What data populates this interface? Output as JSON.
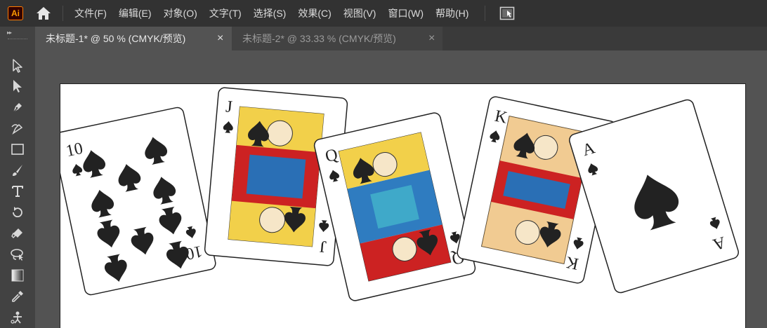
{
  "app": {
    "logo_text": "Ai"
  },
  "menu": {
    "items": [
      "文件(F)",
      "编辑(E)",
      "对象(O)",
      "文字(T)",
      "选择(S)",
      "效果(C)",
      "视图(V)",
      "窗口(W)",
      "帮助(H)"
    ]
  },
  "tabs": [
    {
      "label": "未标题-1* @ 50 % (CMYK/预览)",
      "active": true
    },
    {
      "label": "未标题-2* @ 33.33 % (CMYK/预览)",
      "active": false
    }
  ],
  "tab_close_glyph": "×",
  "tools": [
    "selection-tool-icon",
    "direct-selection-tool-icon",
    "pen-tool-icon",
    "curvature-tool-icon",
    "rectangle-tool-icon",
    "paintbrush-tool-icon",
    "type-tool-icon",
    "rotate-tool-icon",
    "eraser-tool-icon",
    "lasso-tool-icon",
    "gradient-tool-icon",
    "eyedropper-tool-icon",
    "puppet-warp-tool-icon"
  ],
  "artwork": {
    "cards": [
      {
        "rank": "10",
        "suit": "♠"
      },
      {
        "rank": "J",
        "suit": "♠"
      },
      {
        "rank": "Q",
        "suit": "♠"
      },
      {
        "rank": "K",
        "suit": "♠"
      },
      {
        "rank": "A",
        "suit": "♠"
      }
    ]
  },
  "colors": {
    "menubar": "#323232",
    "toolbar": "#424242",
    "tab_active": "#535353",
    "tab_inactive": "#424242",
    "canvas": "#535353",
    "artboard": "#ffffff",
    "logo_border": "#ff7c00"
  }
}
